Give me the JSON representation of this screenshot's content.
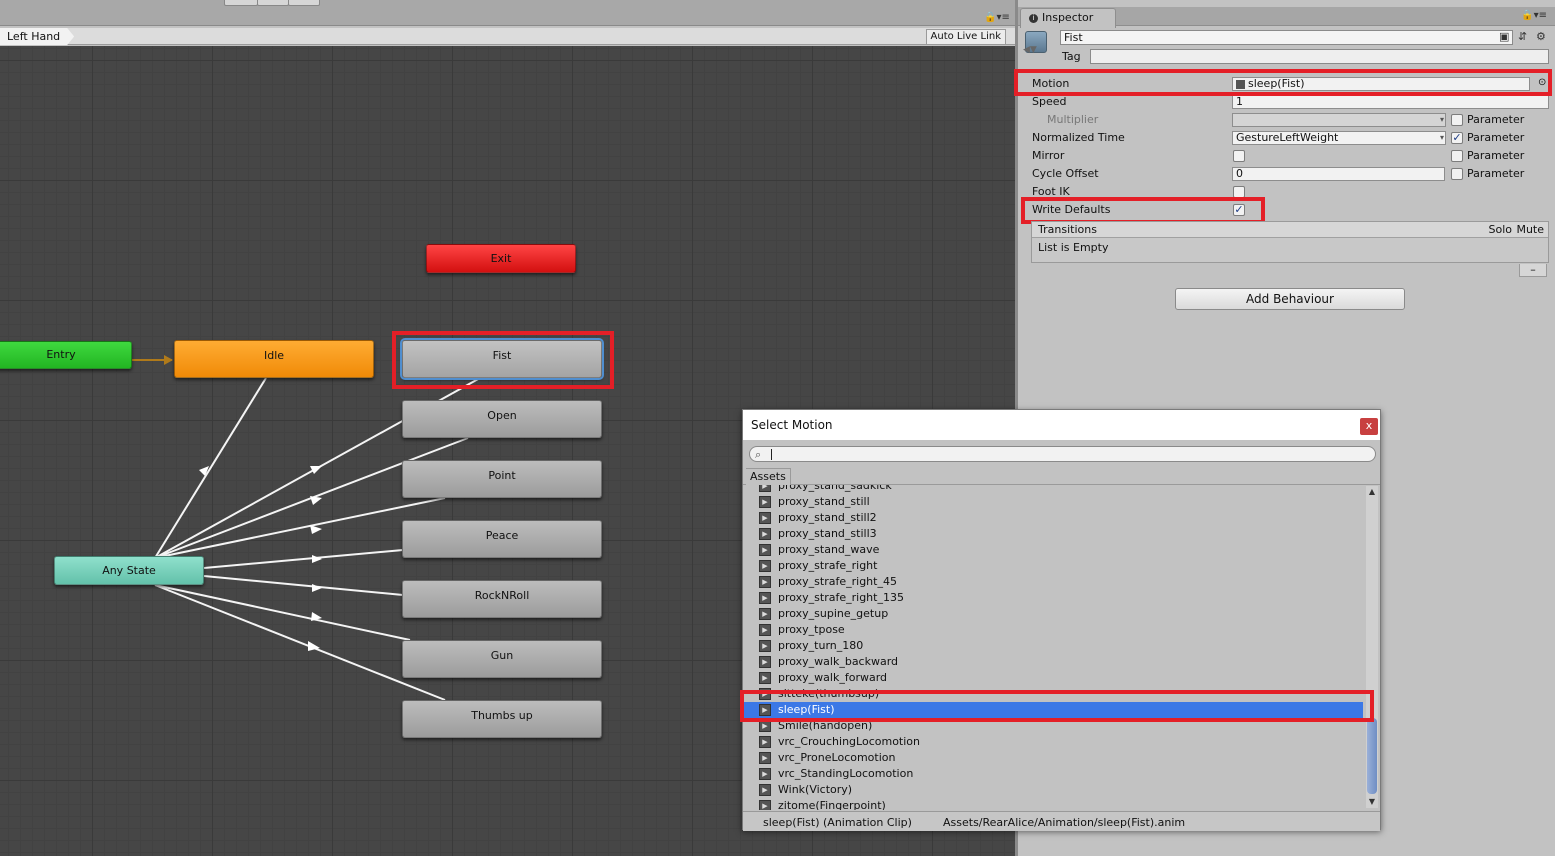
{
  "animator": {
    "breadcrumb": "Left Hand",
    "auto_live_link": "Auto Live Link",
    "lock_icon": "lock-icon",
    "states": {
      "entry": "Entry",
      "idle": "Idle",
      "fist": "Fist",
      "exit": "Exit",
      "any_state": "Any State",
      "open": "Open",
      "point": "Point",
      "peace": "Peace",
      "rocknroll": "RockNRoll",
      "gun": "Gun",
      "thumbs_up": "Thumbs up"
    },
    "colors": {
      "entry": "#2cc42c",
      "idle": "#f8991c",
      "exit": "#e01b1b",
      "any_state": "#73cfb8",
      "state": "#b0b0b0",
      "selected_outline": "#4f8ecf",
      "highlight": "#e41f27"
    }
  },
  "inspector": {
    "tab_label": "Inspector",
    "name": "Fist",
    "tag_label": "Tag",
    "tag_value": "",
    "rows": {
      "motion_label": "Motion",
      "motion_value": "sleep(Fist)",
      "speed_label": "Speed",
      "speed_value": "1",
      "multiplier_label": "Multiplier",
      "multiplier_value": "",
      "normalized_time_label": "Normalized Time",
      "normalized_time_value": "GestureLeftWeight",
      "mirror_label": "Mirror",
      "cycle_offset_label": "Cycle Offset",
      "cycle_offset_value": "0",
      "foot_ik_label": "Foot IK",
      "write_defaults_label": "Write Defaults",
      "parameter_label": "Parameter"
    },
    "checks": {
      "multiplier_param": false,
      "normalized_time_param": true,
      "mirror": false,
      "mirror_param": false,
      "cycle_offset_param": false,
      "foot_ik": false,
      "write_defaults": true
    },
    "transitions": {
      "title": "Transitions",
      "solo": "Solo",
      "mute": "Mute",
      "empty": "List is Empty",
      "remove": "–"
    },
    "add_behaviour": "Add Behaviour"
  },
  "select_motion": {
    "title": "Select Motion",
    "close": "x",
    "search_value": "",
    "tab": "Assets",
    "items": [
      "proxy_stand_sadkick",
      "proxy_stand_still",
      "proxy_stand_still2",
      "proxy_stand_still3",
      "proxy_stand_wave",
      "proxy_strafe_right",
      "proxy_strafe_right_45",
      "proxy_strafe_right_135",
      "proxy_supine_getup",
      "proxy_tpose",
      "proxy_turn_180",
      "proxy_walk_backward",
      "proxy_walk_forward",
      "sitteke(thumbsup)",
      "sleep(Fist)",
      "Smile(handopen)",
      "vrc_CrouchingLocomotion",
      "vrc_ProneLocomotion",
      "vrc_StandingLocomotion",
      "Wink(Victory)",
      "zitome(Fingerpoint)"
    ],
    "selected_index": 14,
    "status_name": "sleep(Fist) (Animation Clip)",
    "status_path": "Assets/RearAlice/Animation/sleep(Fist).anim"
  }
}
